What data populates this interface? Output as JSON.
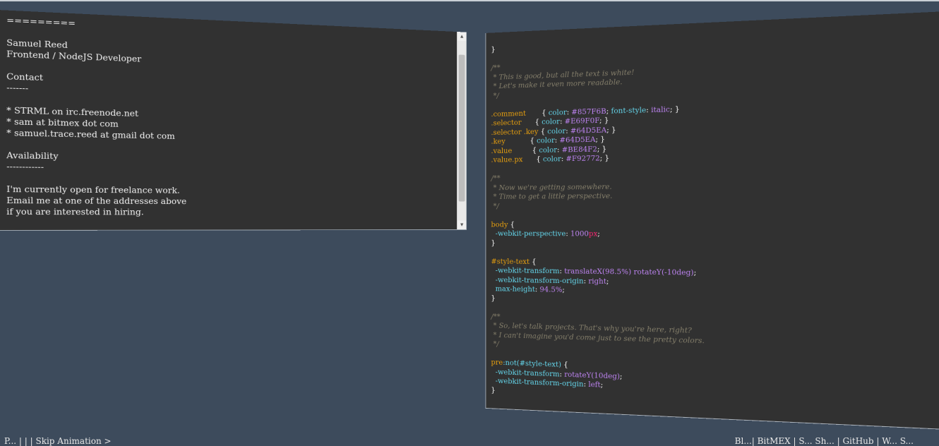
{
  "resume": {
    "heading_rule": "=========",
    "name": "Samuel Reed",
    "role": "Frontend / NodeJS Developer",
    "contact_heading": "Contact",
    "contact_rule": "-------",
    "contact_items": [
      "* STRML on irc.freenode.net",
      "* sam at bitmex dot com",
      "* samuel.trace.reed at gmail dot com"
    ],
    "availability_heading": "Availability",
    "availability_rule": "------------",
    "availability_lines": [
      "I'm currently open for freelance work.",
      "Email me at one of the addresses above",
      "if you are interested in hiring."
    ]
  },
  "style_text": {
    "top_fragment": "}",
    "comment1": [
      "/**",
      " * This is good, but all the text is white!",
      " * Let's make it even more readable.",
      " */"
    ],
    "rules1": [
      {
        "selector": ".comment      ",
        "key": "color",
        "value": "#857F6B",
        "extra_key": "font-style",
        "extra_value": "italic"
      },
      {
        "selector": ".selector     ",
        "key": "color",
        "value": "#E69F0F"
      },
      {
        "selector": ".selector .key",
        "key": "color",
        "value": "#64D5EA"
      },
      {
        "selector": ".key          ",
        "key": "color",
        "value": "#64D5EA"
      },
      {
        "selector": ".value        ",
        "key": "color",
        "value": "#BE84F2"
      },
      {
        "selector": ".value.px     ",
        "key": "color",
        "value": "#F92772"
      }
    ],
    "comment2": [
      "/**",
      " * Now we're getting somewhere.",
      " * Time to get a little perspective.",
      " */"
    ],
    "body_selector": "body",
    "body_key": "-webkit-perspective",
    "body_value": "1000",
    "body_unit": "px",
    "styletext_selector": "#style-text",
    "styletext_key1": "-webkit-transform",
    "styletext_value1": "translateX(98.5%) rotateY(-10deg)",
    "styletext_key2": "-webkit-transform-origin",
    "styletext_value2": "right",
    "styletext_key3": "max-height",
    "styletext_value3": "94.5%",
    "comment3": [
      "/**",
      " * So, let's talk projects. That's why you're here, right?",
      " * I can't imagine you'd come just to see the pretty colors.",
      " */"
    ],
    "pre_selector_a": "pre",
    "pre_selector_b": ":not(#style-text)",
    "pre_key1": "-webkit-transform",
    "pre_value1": "rotateY(10deg)",
    "pre_key2": "-webkit-transform-origin",
    "pre_value2": "left"
  },
  "bottom_bar": {
    "left_text": "P... | | | Skip Animation >",
    "right_text": "Bl...| BitMEX | S... Sh... | GitHub | W... S..."
  },
  "colors": {
    "background": "#3d4b5c",
    "pane": "#313131",
    "comment": "#857F6B",
    "selector": "#E69F0F",
    "key": "#64D5EA",
    "value": "#BE84F2",
    "px": "#F92772"
  }
}
